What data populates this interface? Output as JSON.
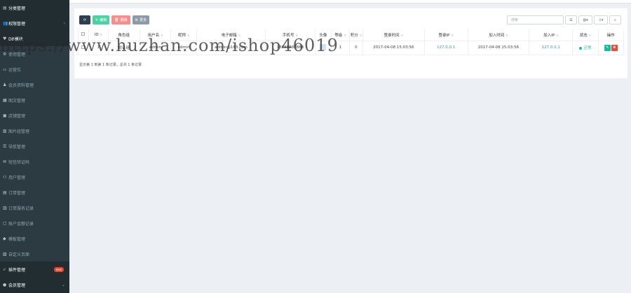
{
  "sidebar": {
    "items": [
      {
        "label": "分类管理",
        "icon": "list-icon",
        "type": "top"
      },
      {
        "label": "权限管理",
        "icon": "group-icon",
        "type": "top",
        "caret": "‹"
      },
      {
        "label": "DB模块",
        "icon": "heart-icon",
        "type": "top"
      },
      {
        "label": "使用管理",
        "icon": "gear-icon",
        "type": "sub"
      },
      {
        "label": "运营位",
        "icon": "box-icon",
        "type": "sub"
      },
      {
        "label": "会员资料管理",
        "icon": "user-icon",
        "type": "sub"
      },
      {
        "label": "图文管理",
        "icon": "table-icon",
        "type": "sub"
      },
      {
        "label": "店铺管理",
        "icon": "store-icon",
        "type": "sub"
      },
      {
        "label": "图片组管理",
        "icon": "image-icon",
        "type": "sub"
      },
      {
        "label": "导航管理",
        "icon": "nav-icon",
        "type": "sub"
      },
      {
        "label": "短信验证码",
        "icon": "sms-icon",
        "type": "sub"
      },
      {
        "label": "用户管理",
        "icon": "people-icon",
        "type": "sub"
      },
      {
        "label": "订单管理",
        "icon": "order-icon",
        "type": "sub"
      },
      {
        "label": "订单服务记录",
        "icon": "record-icon",
        "type": "sub"
      },
      {
        "label": "账户金额记录",
        "icon": "wallet-icon",
        "type": "sub"
      },
      {
        "label": "模板管理",
        "icon": "template-icon",
        "type": "sub"
      },
      {
        "label": "自定义页面",
        "icon": "page-icon",
        "type": "sub"
      },
      {
        "label": "插件管理",
        "icon": "rocket-icon",
        "type": "top",
        "badge": "new"
      },
      {
        "label": "会员管理",
        "icon": "member-icon",
        "type": "top",
        "caret": "⌄"
      }
    ]
  },
  "toolbar": {
    "refresh_icon": "refresh-icon",
    "edit_label": "编辑",
    "delete_label": "删除",
    "more_label": "更多"
  },
  "search": {
    "placeholder": "搜索"
  },
  "table": {
    "headers": [
      "ID",
      "角色组",
      "用户名",
      "昵称",
      "电子邮箱",
      "手机号",
      "头像",
      "等级",
      "积分",
      "登录时间",
      "登录IP",
      "加入时间",
      "加入IP",
      "状态",
      "操作"
    ],
    "rows": [
      {
        "id": "1",
        "role": "默认组",
        "username": "admin",
        "nickname": "admin",
        "email": "admin@163.com",
        "mobile": "13888888888",
        "level": "1",
        "score": "0",
        "login_time": "2017-04-08 15:03:56",
        "login_ip": "127.0.0.1",
        "join_time": "2017-04-08 15:03:56",
        "join_ip": "127.0.0.1",
        "status": "正常"
      }
    ]
  },
  "pageinfo": "显示第 1 到第 1 条记录，总共 1 条记录",
  "watermark": "https://www.huzhan.com/ishop46019"
}
